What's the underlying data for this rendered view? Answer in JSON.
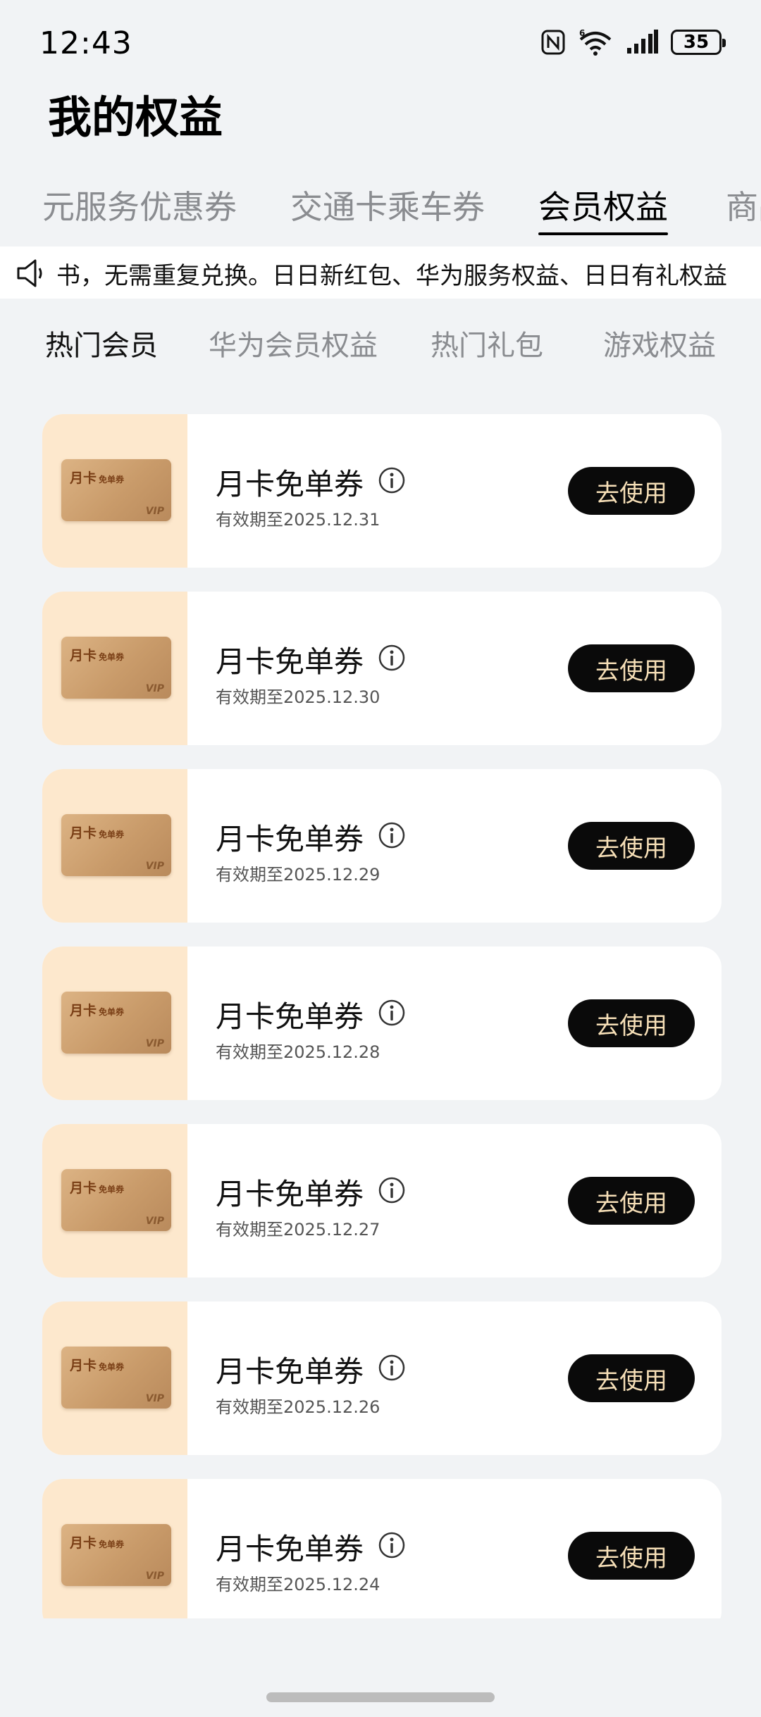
{
  "status_bar": {
    "time": "12:43",
    "battery": "35",
    "icons": [
      "nfc-icon",
      "wifi-6-icon",
      "signal-icon",
      "battery-icon"
    ]
  },
  "page": {
    "title": "我的权益"
  },
  "top_tabs": [
    {
      "label": "元服务优惠券"
    },
    {
      "label": "交通卡乘车券"
    },
    {
      "label": "会员权益"
    },
    {
      "label": "商品"
    }
  ],
  "notice": {
    "icon": "speaker-icon",
    "text": "书，无需重复兑换。日日新红包、华为服务权益、日日有礼权益"
  },
  "sub_tabs": [
    {
      "label": "热门会员"
    },
    {
      "label": "华为会员权益"
    },
    {
      "label": "热门礼包"
    },
    {
      "label": "游戏权益"
    }
  ],
  "coupon_thumb": {
    "title": "月卡",
    "subtitle": "免单券",
    "badge": "VIP"
  },
  "coupons": [
    {
      "name": "月卡免单券",
      "expiry": "有效期至2025.12.31",
      "button": "去使用"
    },
    {
      "name": "月卡免单券",
      "expiry": "有效期至2025.12.30",
      "button": "去使用"
    },
    {
      "name": "月卡免单券",
      "expiry": "有效期至2025.12.29",
      "button": "去使用"
    },
    {
      "name": "月卡免单券",
      "expiry": "有效期至2025.12.28",
      "button": "去使用"
    },
    {
      "name": "月卡免单券",
      "expiry": "有效期至2025.12.27",
      "button": "去使用"
    },
    {
      "name": "月卡免单券",
      "expiry": "有效期至2025.12.26",
      "button": "去使用"
    },
    {
      "name": "月卡免单券",
      "expiry": "有效期至2025.12.24",
      "button": "去使用"
    }
  ],
  "colors": {
    "background": "#f1f3f5",
    "button_bg": "#0a0a0a",
    "button_text": "#f6dfb7",
    "thumb_bg": "#fde8cd"
  }
}
